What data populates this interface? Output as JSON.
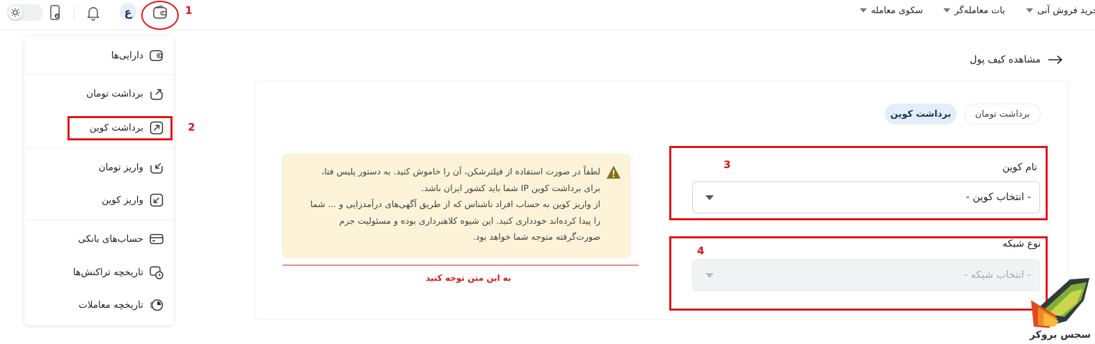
{
  "topbar": {
    "nav": [
      {
        "label": "سکوی معامله"
      },
      {
        "label": "بات معامله‌گر"
      },
      {
        "label": "خرید فروش آنی"
      }
    ],
    "badge_letter": "ع"
  },
  "menu": {
    "items": [
      {
        "label": "دارایی‌ها",
        "icon": "wallet-icon"
      },
      {
        "label": "برداشت تومان",
        "icon": "withdraw-toman-icon"
      },
      {
        "label": "برداشت کوین",
        "icon": "withdraw-coin-icon"
      },
      {
        "label": "واریز تومان",
        "icon": "deposit-toman-icon"
      },
      {
        "label": "واریز کوین",
        "icon": "deposit-coin-icon"
      },
      {
        "label": "حساب‌های بانکی",
        "icon": "bank-card-icon"
      },
      {
        "label": "تاریخچه تراکنش‌ها",
        "icon": "transaction-history-icon"
      },
      {
        "label": "تاریخچه معاملات",
        "icon": "trade-history-icon"
      }
    ]
  },
  "main": {
    "back_link": "مشاهده کیف پول",
    "tabs": [
      {
        "label": "برداشت کوین",
        "active": true
      },
      {
        "label": "برداشت تومان",
        "active": false
      }
    ],
    "coin_field": {
      "label": "نام کوین",
      "value": "- انتخاب کوین -"
    },
    "network_field": {
      "label": "نوع شبکه",
      "value": "- انتخاب شبکه -",
      "disabled": true
    },
    "warning": {
      "lines": [
        "لطفاً در صورت استفاده از فیلترشکن، آن را خاموش کنید. به دستور پلیس فتا،",
        "برای برداشت کوین IP شما باید کشور ایران باشد.",
        "از واریز کوین به حساب افراد ناشناس که از طریق آگهی‌های درآمدزایی و ... شما",
        "را پیدا کرده‌اند خودداری کنید. این شیوه کلاهبرداری بوده و مسئولیت جرم",
        "صورت‌گرفته متوجه شما خواهد بود."
      ]
    },
    "note": "به این متن توجه کنید"
  },
  "annotations": {
    "n1": "1",
    "n2": "2",
    "n3": "3",
    "n4": "4"
  },
  "watermark": {
    "text": "سجس بروکر"
  },
  "colors": {
    "annotation_red": "#e3141b",
    "tab_active_bg": "#e2eefa",
    "warning_bg": "#fdf3d9"
  }
}
